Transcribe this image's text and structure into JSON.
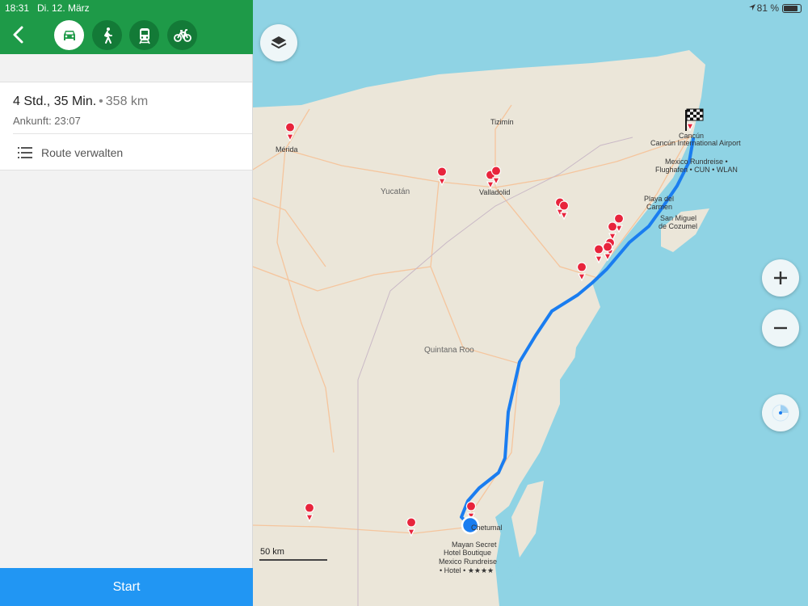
{
  "status": {
    "time": "18:31",
    "date": "Di. 12. März",
    "battery": "81 %"
  },
  "modes": [
    {
      "name": "car",
      "active": true
    },
    {
      "name": "walk",
      "active": false
    },
    {
      "name": "train",
      "active": false
    },
    {
      "name": "bike",
      "active": false
    }
  ],
  "route": {
    "duration": "4 Std., 35 Min.",
    "separator": "•",
    "distance": "358 km",
    "arrival": "Ankunft: 23:07",
    "manage_label": "Route verwalten"
  },
  "start_label": "Start",
  "map": {
    "scale_label": "50 km",
    "places": {
      "merida": "Mérida",
      "tizimin": "Tizimín",
      "yucatan": "Yucatán",
      "valladolid": "Valladolid",
      "cancun": "Cancún",
      "airport": "Cancún International Airport",
      "airport_poi_1": "Mexico Rundreise •",
      "airport_poi_2": "Flughafen • CUN • WLAN",
      "playa_1": "Playa del",
      "playa_2": "Carmen",
      "cozumel_1": "San Miguel",
      "cozumel_2": "de Cozumel",
      "quintana": "Quintana Roo",
      "chetumal": "Chetumal",
      "hotel_1": "Mayan Secret",
      "hotel_2": "Hotel Boutique",
      "hotel_3": "Mexico Rundreise",
      "hotel_4": "• Hotel • ★★★★"
    }
  },
  "colors": {
    "header_green": "#1e9a48",
    "start_blue": "#2196f3",
    "route_blue": "#1a7df0",
    "water": "#8fd3e4",
    "land": "#ebe6d9",
    "pin_red": "#e8243c"
  },
  "icons": {
    "back": "chevron-left-icon",
    "car": "car-icon",
    "walk": "walk-icon",
    "train": "train-icon",
    "bike": "bike-icon",
    "list": "list-icon",
    "layers": "layers-icon",
    "zoom_in": "plus-icon",
    "zoom_out": "minus-icon",
    "compass": "compass-icon",
    "finish": "checkered-flag-icon"
  }
}
